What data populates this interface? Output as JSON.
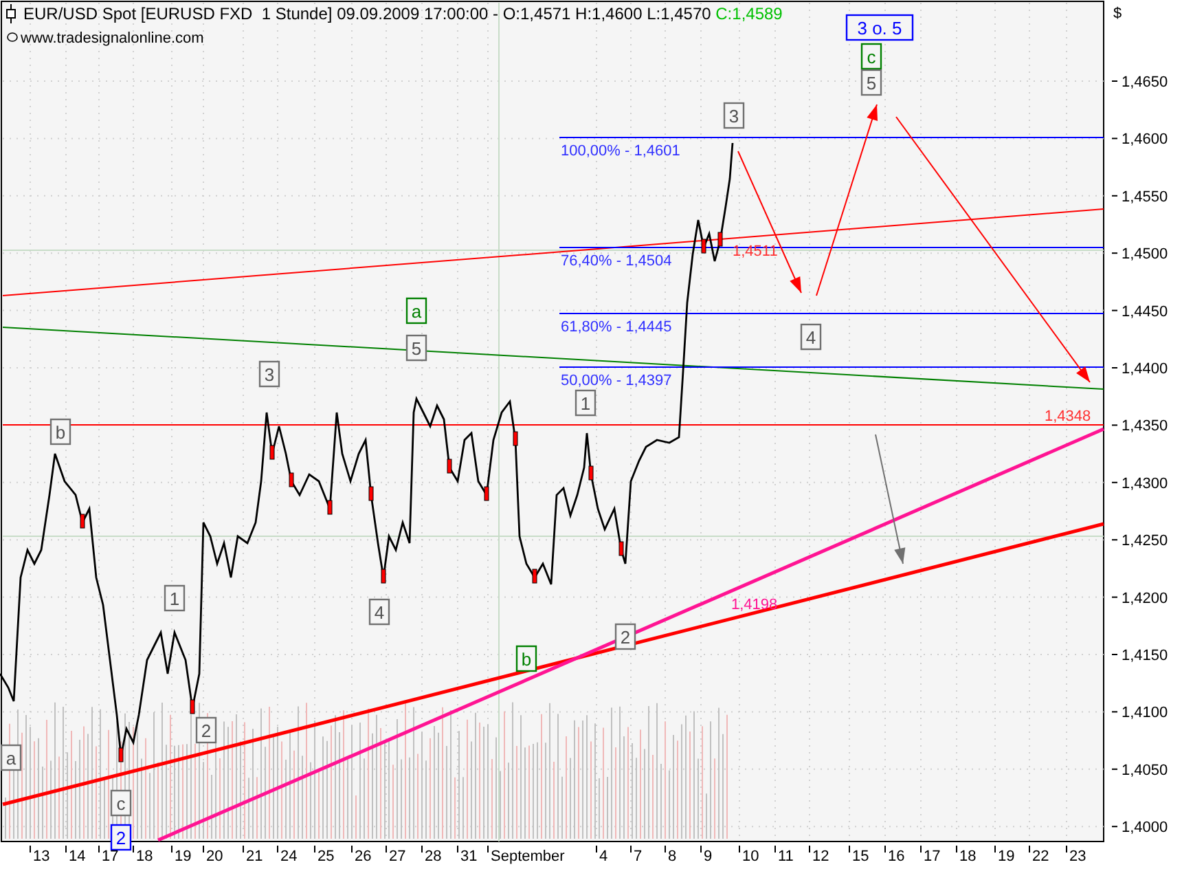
{
  "chart": {
    "header": {
      "instrument": "EUR/USD Spot [EURUSD FXD  1 Stunde] 09.09.2009 17:00:00 - O:1,4571 H:1,4600 L:1,4570",
      "close": "C:1,4589",
      "source": "www.tradesignalonline.com"
    },
    "currency": "$",
    "y_ticks": [
      "1,4650",
      "1,4600",
      "1,4550",
      "1,4500",
      "1,4450",
      "1,4400",
      "1,4350",
      "1,4300",
      "1,4250",
      "1,4200",
      "1,4150",
      "1,4100",
      "1,4050",
      "1,4000"
    ],
    "x_labels": [
      "13",
      "14",
      "17",
      "18",
      "19",
      "20",
      "21",
      "24",
      "25",
      "26",
      "27",
      "28",
      "31",
      "September",
      "4",
      "7",
      "8",
      "9",
      "10",
      "11",
      "12",
      "15",
      "16",
      "17",
      "18",
      "19",
      "22",
      "23"
    ],
    "fib_levels": [
      {
        "label": "100,00% - 1,4601"
      },
      {
        "label": "76,40% - 1,4504"
      },
      {
        "label": "61,80% - 1,4445"
      },
      {
        "label": "50,00% - 1,4397"
      }
    ],
    "price_tags": [
      {
        "text": "1,4511",
        "color": "#ff3030"
      },
      {
        "text": "1,4348",
        "color": "#ff3030"
      },
      {
        "text": "1,4198",
        "color": "#ff1493"
      }
    ],
    "wave_labels": [
      {
        "text": "a",
        "color": "#707070"
      },
      {
        "text": "b",
        "color": "#707070"
      },
      {
        "text": "c",
        "color": "#707070"
      },
      {
        "text": "2",
        "color": "#0000ff"
      },
      {
        "text": "1",
        "color": "#707070"
      },
      {
        "text": "2",
        "color": "#707070"
      },
      {
        "text": "3",
        "color": "#707070"
      },
      {
        "text": "4",
        "color": "#707070"
      },
      {
        "text": "5",
        "color": "#707070"
      },
      {
        "text": "a",
        "color": "#008000"
      },
      {
        "text": "1",
        "color": "#707070"
      },
      {
        "text": "b",
        "color": "#008000"
      },
      {
        "text": "2",
        "color": "#707070"
      },
      {
        "text": "3",
        "color": "#707070"
      },
      {
        "text": "4",
        "color": "#707070"
      },
      {
        "text": "3 o. 5",
        "color": "#0000ff"
      },
      {
        "text": "c",
        "color": "#008000"
      },
      {
        "text": "5",
        "color": "#707070"
      }
    ]
  }
}
